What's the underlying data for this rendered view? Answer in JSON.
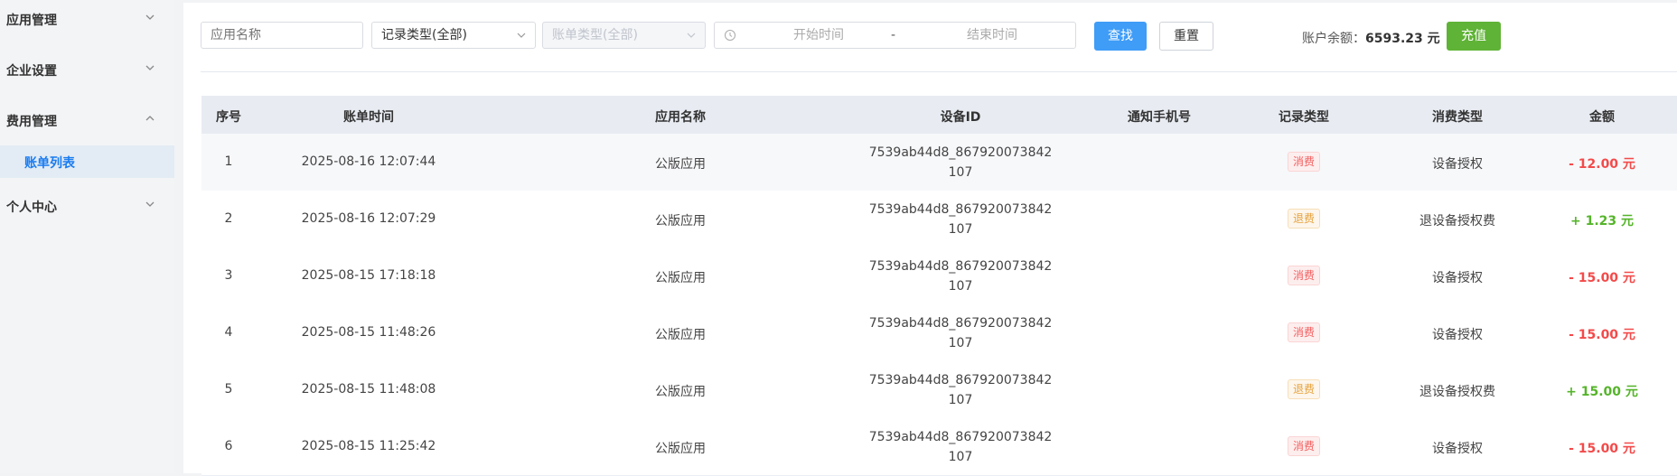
{
  "sidebar": {
    "groups": [
      {
        "label": "应用管理"
      },
      {
        "label": "企业设置"
      },
      {
        "label": "费用管理"
      },
      {
        "label": "个人中心"
      }
    ],
    "sub_item": "账单列表"
  },
  "filters": {
    "app_name_placeholder": "应用名称",
    "record_type": "记录类型(全部)",
    "bill_type": "账单类型(全部)",
    "start_placeholder": "开始时间",
    "separator": "-",
    "end_placeholder": "结束时间",
    "search_label": "查找",
    "reset_label": "重置"
  },
  "account": {
    "balance_label": "账户余额：",
    "balance_value": "6593.23 元",
    "recharge_label": "充值"
  },
  "table": {
    "headers": [
      "序号",
      "账单时间",
      "应用名称",
      "设备ID",
      "通知手机号",
      "记录类型",
      "消费类型",
      "金额"
    ],
    "rows": [
      {
        "no": "1",
        "time": "2025-08-16 12:07:44",
        "app": "公版应用",
        "device_l1": "7539ab44d8_867920073842",
        "device_l2": "107",
        "phone": "",
        "record": "消费",
        "consume": "设备授权",
        "amount": "- 12.00 元"
      },
      {
        "no": "2",
        "time": "2025-08-16 12:07:29",
        "app": "公版应用",
        "device_l1": "7539ab44d8_867920073842",
        "device_l2": "107",
        "phone": "",
        "record": "退费",
        "consume": "退设备授权费",
        "amount": "+ 1.23 元"
      },
      {
        "no": "3",
        "time": "2025-08-15 17:18:18",
        "app": "公版应用",
        "device_l1": "7539ab44d8_867920073842",
        "device_l2": "107",
        "phone": "",
        "record": "消费",
        "consume": "设备授权",
        "amount": "- 15.00 元"
      },
      {
        "no": "4",
        "time": "2025-08-15 11:48:26",
        "app": "公版应用",
        "device_l1": "7539ab44d8_867920073842",
        "device_l2": "107",
        "phone": "",
        "record": "消费",
        "consume": "设备授权",
        "amount": "- 15.00 元"
      },
      {
        "no": "5",
        "time": "2025-08-15 11:48:08",
        "app": "公版应用",
        "device_l1": "7539ab44d8_867920073842",
        "device_l2": "107",
        "phone": "",
        "record": "退费",
        "consume": "退设备授权费",
        "amount": "+ 15.00 元"
      },
      {
        "no": "6",
        "time": "2025-08-15 11:25:42",
        "app": "公版应用",
        "device_l1": "7539ab44d8_867920073842",
        "device_l2": "107",
        "phone": "",
        "record": "消费",
        "consume": "设备授权",
        "amount": "- 15.00 元"
      }
    ]
  },
  "colors": {
    "accent": "#1a7cf0",
    "primary_button": "#3f9cf7",
    "success_button": "#5fb336",
    "amount_negative": "#f34a4a",
    "amount_positive": "#55b42a"
  },
  "icons": {
    "chevron": "chevron-down-icon",
    "chevron_open": "chevron-up-icon",
    "clock": "clock-icon",
    "caret": "caret-down-icon"
  }
}
